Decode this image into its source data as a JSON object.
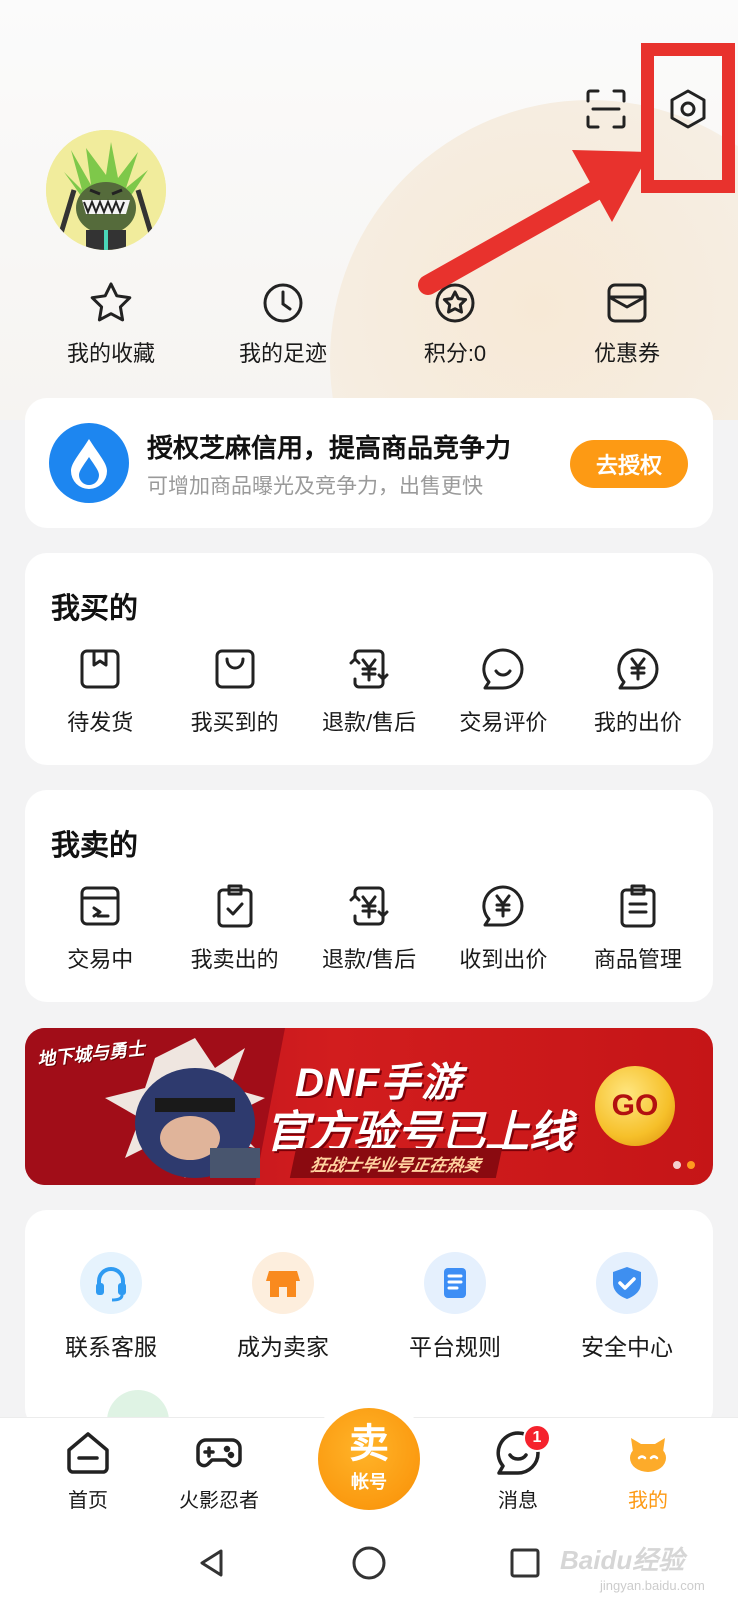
{
  "header": {
    "scan_icon": "scan-icon",
    "settings_icon": "hexagon-settings-icon"
  },
  "quick_links": [
    {
      "label": "我的收藏",
      "icon": "star-icon"
    },
    {
      "label": "我的足迹",
      "icon": "clock-icon"
    },
    {
      "label": "积分:0",
      "icon": "points-star-icon"
    },
    {
      "label": "优惠券",
      "icon": "coupon-icon"
    }
  ],
  "auth": {
    "title": "授权芝麻信用，提高商品竞争力",
    "subtitle": "可增加商品曝光及竞争力，出售更快",
    "button": "去授权"
  },
  "buy": {
    "title": "我买的",
    "items": [
      {
        "label": "待发货",
        "icon": "package-box-icon"
      },
      {
        "label": "我买到的",
        "icon": "shopping-bag-icon"
      },
      {
        "label": "退款/售后",
        "icon": "refund-yen-icon"
      },
      {
        "label": "交易评价",
        "icon": "smile-chat-icon"
      },
      {
        "label": "我的出价",
        "icon": "yen-chat-icon"
      }
    ]
  },
  "sell": {
    "title": "我卖的",
    "items": [
      {
        "label": "交易中",
        "icon": "trading-box-icon"
      },
      {
        "label": "我卖出的",
        "icon": "clipboard-check-icon"
      },
      {
        "label": "退款/售后",
        "icon": "refund-yen-icon"
      },
      {
        "label": "收到出价",
        "icon": "yen-chat-icon"
      },
      {
        "label": "商品管理",
        "icon": "clipboard-list-icon"
      }
    ]
  },
  "banner": {
    "logo": "地下城与勇士",
    "line1": "DNF手游",
    "line2": "官方验号已上线",
    "tag": "狂战士毕业号正在热卖",
    "go": "GO"
  },
  "services": [
    {
      "label": "联系客服",
      "icon": "headset-icon",
      "color": "#2f9bf2",
      "bg": "#e6f3fd"
    },
    {
      "label": "成为卖家",
      "icon": "shop-icon",
      "color": "#f98a1e",
      "bg": "#fdeedd"
    },
    {
      "label": "平台规则",
      "icon": "document-icon",
      "color": "#3d8ef5",
      "bg": "#e5f0fd"
    },
    {
      "label": "安全中心",
      "icon": "shield-check-icon",
      "color": "#3e8ff0",
      "bg": "#e5f0fd"
    }
  ],
  "tabbar": {
    "items": [
      {
        "label": "首页",
        "icon": "home-icon"
      },
      {
        "label": "火影忍者",
        "icon": "gamepad-icon"
      },
      {
        "label": "消息",
        "icon": "message-bubble-icon",
        "badge": "1"
      },
      {
        "label": "我的",
        "icon": "cat-face-icon"
      }
    ],
    "sell_main": "卖",
    "sell_sub": "帐号"
  },
  "colors": {
    "accent": "#fd9a14",
    "annotation": "#e8322d",
    "badge": "#f5222d"
  },
  "watermark": {
    "main": "Baidu经验",
    "sub": "jingyan.baidu.com"
  }
}
